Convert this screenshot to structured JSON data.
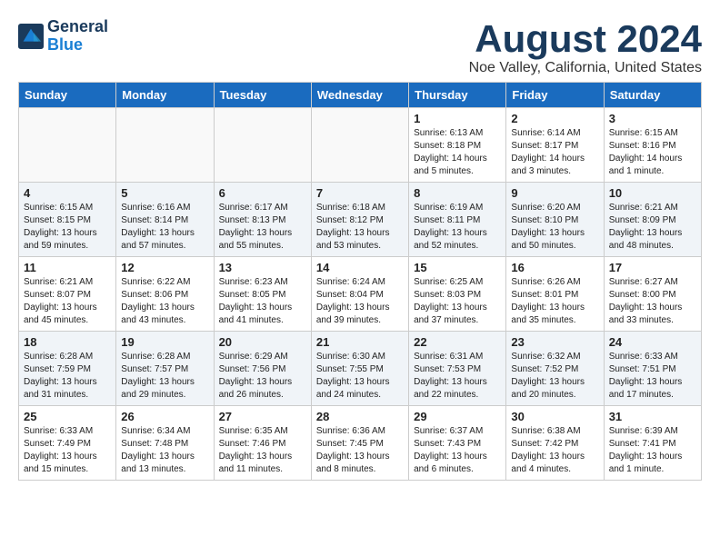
{
  "logo": {
    "general": "General",
    "blue": "Blue"
  },
  "header": {
    "title": "August 2024",
    "subtitle": "Noe Valley, California, United States"
  },
  "weekdays": [
    "Sunday",
    "Monday",
    "Tuesday",
    "Wednesday",
    "Thursday",
    "Friday",
    "Saturday"
  ],
  "weeks": [
    [
      {
        "day": "",
        "info": ""
      },
      {
        "day": "",
        "info": ""
      },
      {
        "day": "",
        "info": ""
      },
      {
        "day": "",
        "info": ""
      },
      {
        "day": "1",
        "info": "Sunrise: 6:13 AM\nSunset: 8:18 PM\nDaylight: 14 hours\nand 5 minutes."
      },
      {
        "day": "2",
        "info": "Sunrise: 6:14 AM\nSunset: 8:17 PM\nDaylight: 14 hours\nand 3 minutes."
      },
      {
        "day": "3",
        "info": "Sunrise: 6:15 AM\nSunset: 8:16 PM\nDaylight: 14 hours\nand 1 minute."
      }
    ],
    [
      {
        "day": "4",
        "info": "Sunrise: 6:15 AM\nSunset: 8:15 PM\nDaylight: 13 hours\nand 59 minutes."
      },
      {
        "day": "5",
        "info": "Sunrise: 6:16 AM\nSunset: 8:14 PM\nDaylight: 13 hours\nand 57 minutes."
      },
      {
        "day": "6",
        "info": "Sunrise: 6:17 AM\nSunset: 8:13 PM\nDaylight: 13 hours\nand 55 minutes."
      },
      {
        "day": "7",
        "info": "Sunrise: 6:18 AM\nSunset: 8:12 PM\nDaylight: 13 hours\nand 53 minutes."
      },
      {
        "day": "8",
        "info": "Sunrise: 6:19 AM\nSunset: 8:11 PM\nDaylight: 13 hours\nand 52 minutes."
      },
      {
        "day": "9",
        "info": "Sunrise: 6:20 AM\nSunset: 8:10 PM\nDaylight: 13 hours\nand 50 minutes."
      },
      {
        "day": "10",
        "info": "Sunrise: 6:21 AM\nSunset: 8:09 PM\nDaylight: 13 hours\nand 48 minutes."
      }
    ],
    [
      {
        "day": "11",
        "info": "Sunrise: 6:21 AM\nSunset: 8:07 PM\nDaylight: 13 hours\nand 45 minutes."
      },
      {
        "day": "12",
        "info": "Sunrise: 6:22 AM\nSunset: 8:06 PM\nDaylight: 13 hours\nand 43 minutes."
      },
      {
        "day": "13",
        "info": "Sunrise: 6:23 AM\nSunset: 8:05 PM\nDaylight: 13 hours\nand 41 minutes."
      },
      {
        "day": "14",
        "info": "Sunrise: 6:24 AM\nSunset: 8:04 PM\nDaylight: 13 hours\nand 39 minutes."
      },
      {
        "day": "15",
        "info": "Sunrise: 6:25 AM\nSunset: 8:03 PM\nDaylight: 13 hours\nand 37 minutes."
      },
      {
        "day": "16",
        "info": "Sunrise: 6:26 AM\nSunset: 8:01 PM\nDaylight: 13 hours\nand 35 minutes."
      },
      {
        "day": "17",
        "info": "Sunrise: 6:27 AM\nSunset: 8:00 PM\nDaylight: 13 hours\nand 33 minutes."
      }
    ],
    [
      {
        "day": "18",
        "info": "Sunrise: 6:28 AM\nSunset: 7:59 PM\nDaylight: 13 hours\nand 31 minutes."
      },
      {
        "day": "19",
        "info": "Sunrise: 6:28 AM\nSunset: 7:57 PM\nDaylight: 13 hours\nand 29 minutes."
      },
      {
        "day": "20",
        "info": "Sunrise: 6:29 AM\nSunset: 7:56 PM\nDaylight: 13 hours\nand 26 minutes."
      },
      {
        "day": "21",
        "info": "Sunrise: 6:30 AM\nSunset: 7:55 PM\nDaylight: 13 hours\nand 24 minutes."
      },
      {
        "day": "22",
        "info": "Sunrise: 6:31 AM\nSunset: 7:53 PM\nDaylight: 13 hours\nand 22 minutes."
      },
      {
        "day": "23",
        "info": "Sunrise: 6:32 AM\nSunset: 7:52 PM\nDaylight: 13 hours\nand 20 minutes."
      },
      {
        "day": "24",
        "info": "Sunrise: 6:33 AM\nSunset: 7:51 PM\nDaylight: 13 hours\nand 17 minutes."
      }
    ],
    [
      {
        "day": "25",
        "info": "Sunrise: 6:33 AM\nSunset: 7:49 PM\nDaylight: 13 hours\nand 15 minutes."
      },
      {
        "day": "26",
        "info": "Sunrise: 6:34 AM\nSunset: 7:48 PM\nDaylight: 13 hours\nand 13 minutes."
      },
      {
        "day": "27",
        "info": "Sunrise: 6:35 AM\nSunset: 7:46 PM\nDaylight: 13 hours\nand 11 minutes."
      },
      {
        "day": "28",
        "info": "Sunrise: 6:36 AM\nSunset: 7:45 PM\nDaylight: 13 hours\nand 8 minutes."
      },
      {
        "day": "29",
        "info": "Sunrise: 6:37 AM\nSunset: 7:43 PM\nDaylight: 13 hours\nand 6 minutes."
      },
      {
        "day": "30",
        "info": "Sunrise: 6:38 AM\nSunset: 7:42 PM\nDaylight: 13 hours\nand 4 minutes."
      },
      {
        "day": "31",
        "info": "Sunrise: 6:39 AM\nSunset: 7:41 PM\nDaylight: 13 hours\nand 1 minute."
      }
    ]
  ]
}
